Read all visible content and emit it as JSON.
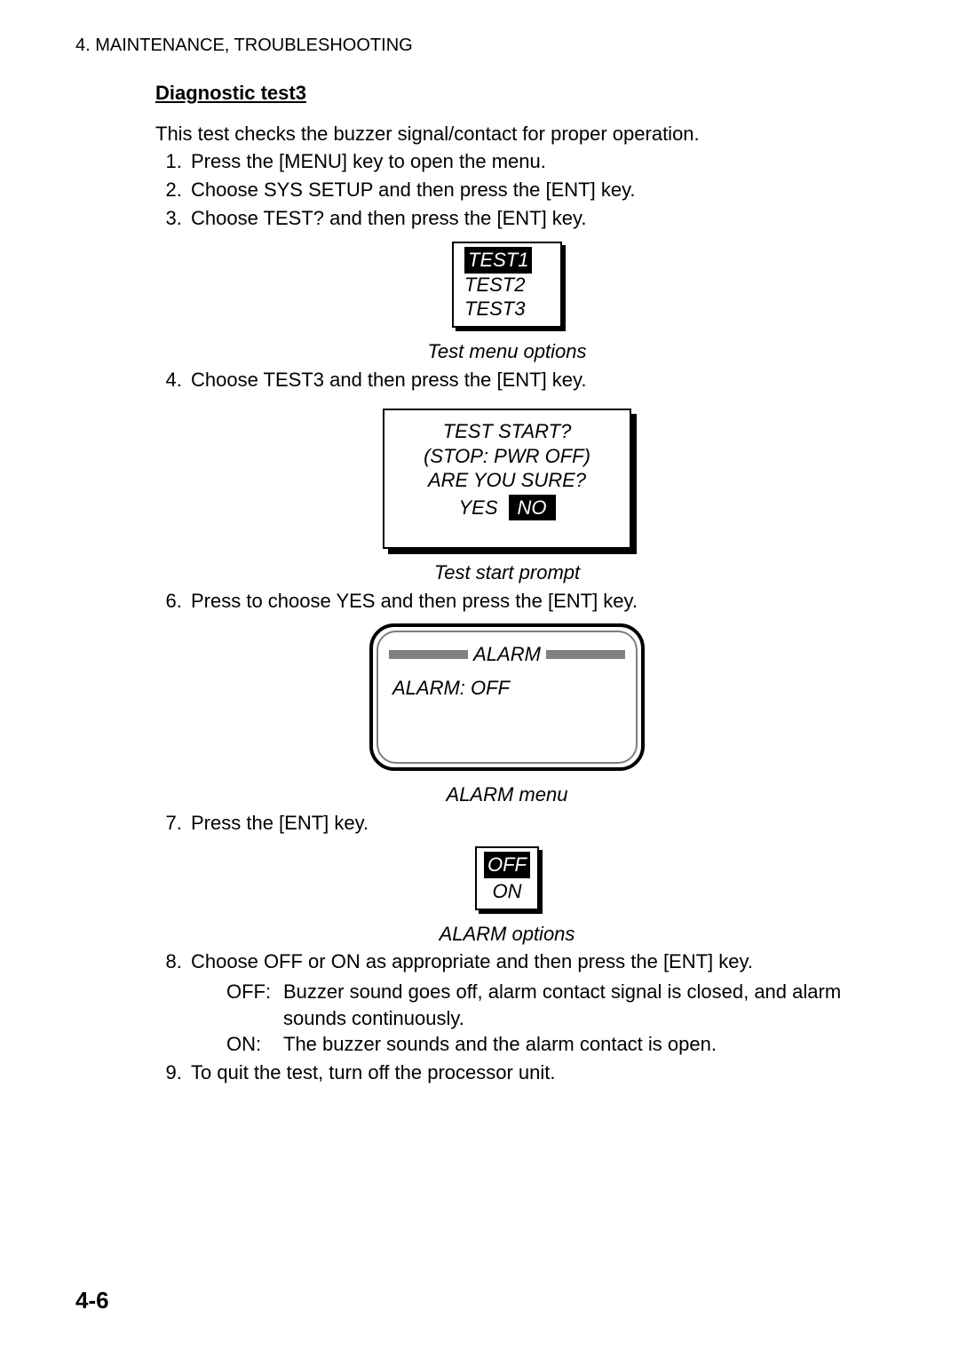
{
  "header": "4. MAINTENANCE, TROUBLESHOOTING",
  "section_title": "Diagnostic test3",
  "intro": "This test checks the buzzer signal/contact for proper operation.",
  "steps": {
    "s1": "Press the [MENU] key to open the menu.",
    "s2": "Choose SYS SETUP and then press the [ENT] key.",
    "s3": "Choose TEST? and then press the [ENT] key.",
    "s4": "Choose TEST3 and then press the [ENT] key.",
    "s6": "Press      to choose YES and then press the [ENT] key.",
    "s7": "Press the [ENT] key.",
    "s8": "Choose OFF or ON as appropriate and then press the [ENT] key.",
    "s9": "To quit the test, turn off the processor unit."
  },
  "test_menu": {
    "items": [
      "TEST1",
      "TEST2",
      "TEST3"
    ],
    "caption": "Test menu options"
  },
  "prompt": {
    "line1": "TEST START?",
    "line2": "(STOP: PWR OFF)",
    "line3": "ARE YOU SURE?",
    "yes": "YES",
    "no": "NO",
    "caption": "Test start prompt"
  },
  "alarm_screen": {
    "title": "ALARM",
    "line": "ALARM: OFF",
    "caption": "ALARM menu"
  },
  "alarm_options": {
    "items": [
      "OFF",
      "ON"
    ],
    "caption": "ALARM options"
  },
  "defs": {
    "off_label": "OFF:",
    "off_text": "Buzzer sound goes off, alarm contact signal is closed, and alarm sounds continuously.",
    "on_label": "ON:",
    "on_text": "The buzzer sounds and the alarm contact is open."
  },
  "footer": "4-6"
}
